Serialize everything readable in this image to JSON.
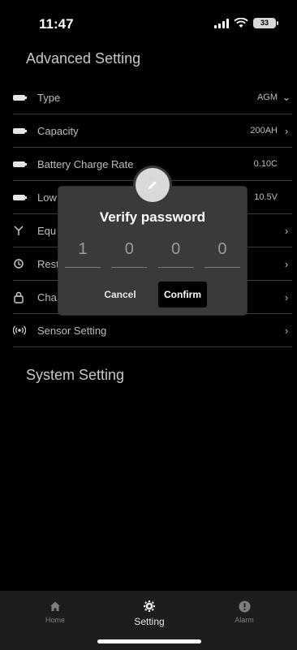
{
  "status_bar": {
    "time": "11:47",
    "battery": "33"
  },
  "advanced": {
    "title": "Advanced Setting",
    "rows": [
      {
        "label": "Type",
        "value": "AGM",
        "chevron": "chevron-down-icon"
      },
      {
        "label": "Capacity",
        "value": "200AH",
        "chevron": "chevron-right-icon"
      },
      {
        "label": "Battery Charge Rate",
        "value": "0.10C"
      },
      {
        "label": "Low",
        "value": "10.5V"
      },
      {
        "label": "Equ",
        "chevron": "chevron-right-icon"
      },
      {
        "label": "Rest",
        "chevron": "chevron-right-icon"
      },
      {
        "label": "Cha",
        "chevron": "chevron-right-icon"
      },
      {
        "label": "Sensor Setting",
        "chevron": "chevron-right-icon"
      }
    ]
  },
  "system": {
    "title": "System Setting"
  },
  "modal": {
    "title": "Verify password",
    "digits": [
      "1",
      "0",
      "0",
      "0"
    ],
    "cancel_label": "Cancel",
    "confirm_label": "Confirm"
  },
  "tabbar": {
    "home": "Home",
    "setting": "Setting",
    "alarm": "Alarm"
  }
}
